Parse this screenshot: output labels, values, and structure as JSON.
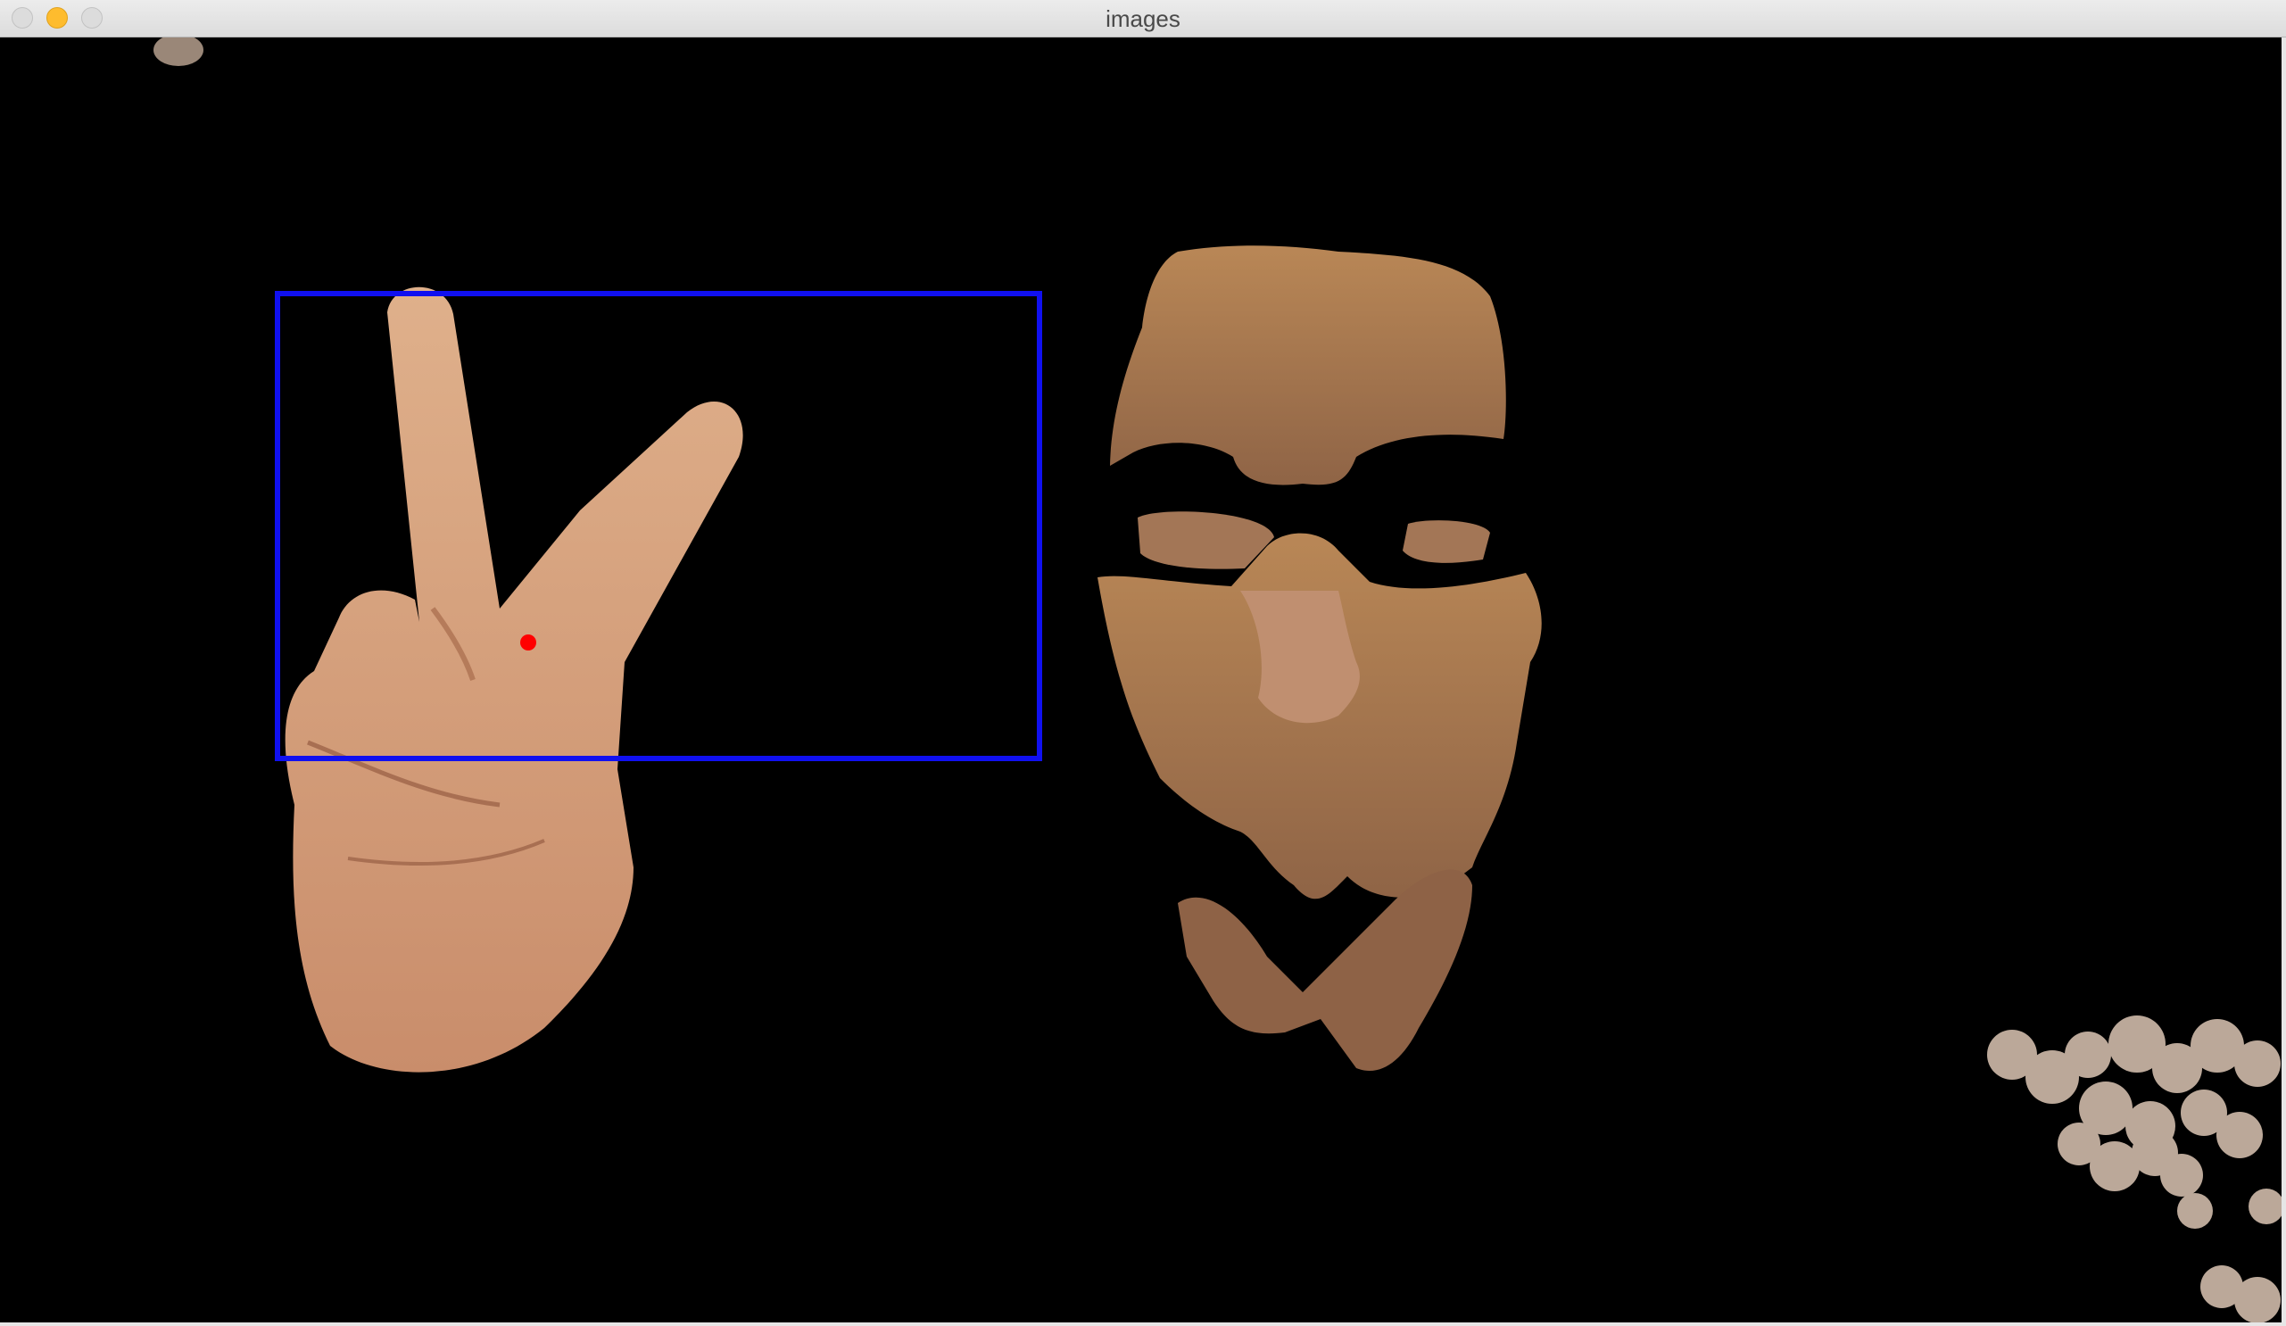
{
  "window": {
    "title": "images"
  },
  "scene": {
    "bounding_box_color": "#1010f0",
    "marker_color": "#ff0000",
    "skin_color": "#d7a27d"
  }
}
